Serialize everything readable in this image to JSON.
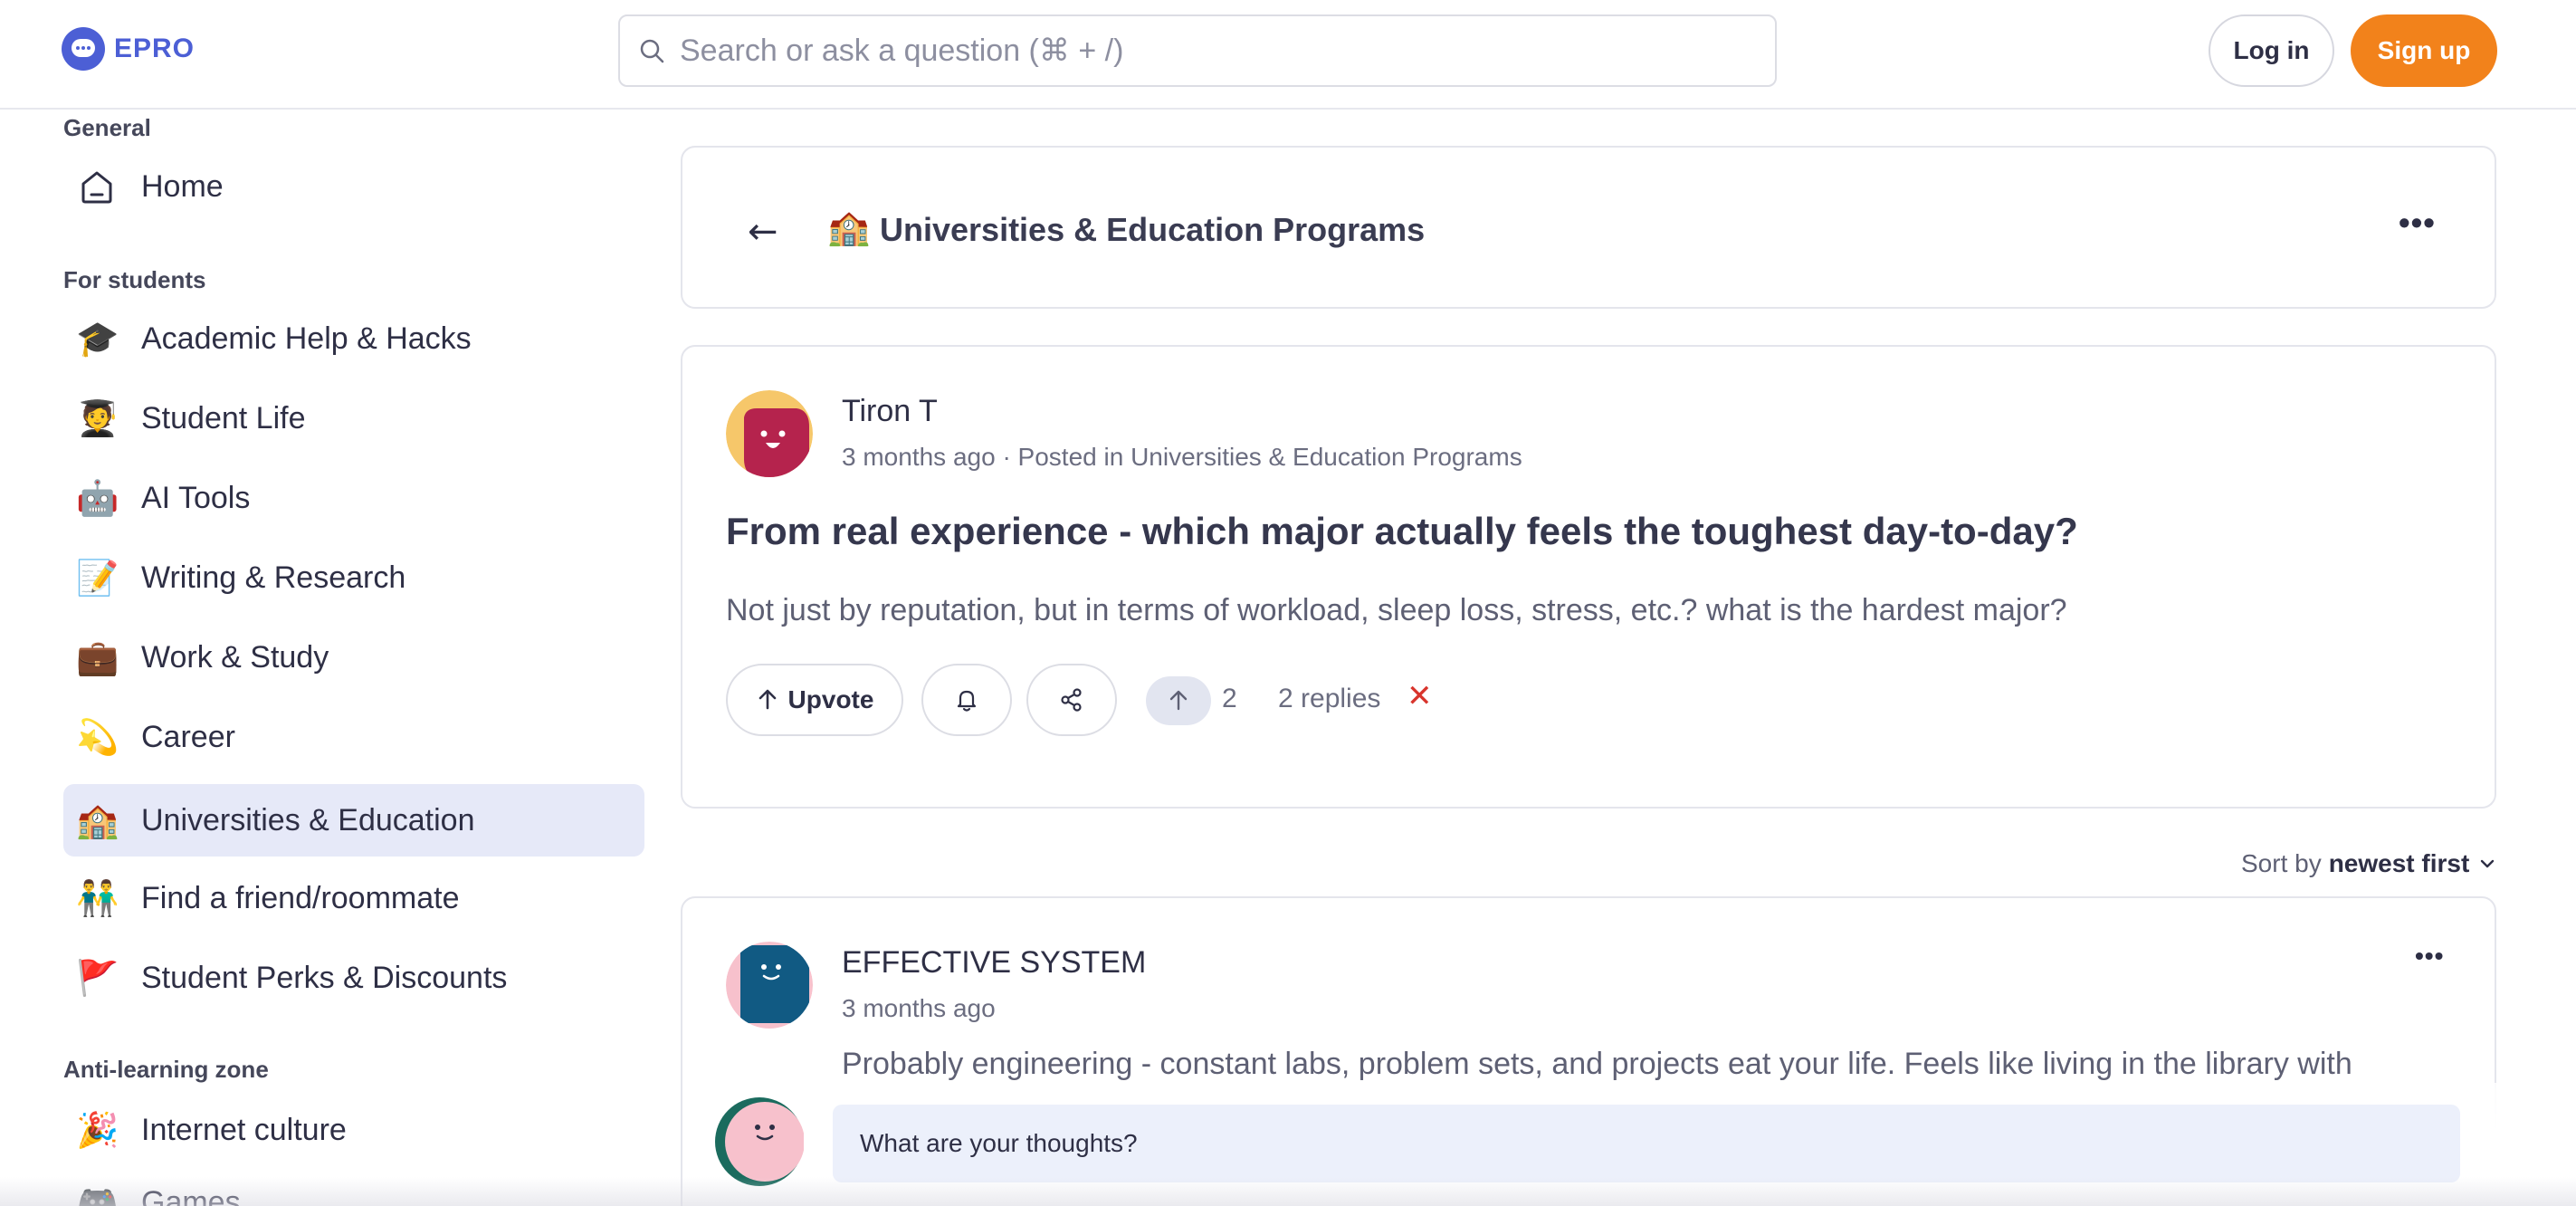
{
  "header": {
    "logo_text": "EPRO",
    "search_placeholder": "Search or ask a question (⌘ + /)",
    "login_label": "Log in",
    "signup_label": "Sign up",
    "accent_color": "#4c5fd5",
    "signup_color": "#f2821b"
  },
  "sidebar": {
    "sections": [
      {
        "title": "General"
      },
      {
        "title": "For students"
      },
      {
        "title": "Anti-learning zone"
      }
    ],
    "items": [
      {
        "label": "Home",
        "icon": "home-icon"
      },
      {
        "label": "Academic Help & Hacks",
        "icon": "graduation-cap-icon",
        "emoji": "🎓"
      },
      {
        "label": "Student Life",
        "icon": "student-icon",
        "emoji": "🧑‍🎓"
      },
      {
        "label": "AI Tools",
        "icon": "robot-icon",
        "emoji": "🤖"
      },
      {
        "label": "Writing & Research",
        "icon": "memo-icon",
        "emoji": "📝"
      },
      {
        "label": "Work & Study",
        "icon": "briefcase-icon",
        "emoji": "💼"
      },
      {
        "label": "Career",
        "icon": "dizzy-icon",
        "emoji": "💫"
      },
      {
        "label": "Universities & Education",
        "icon": "school-icon",
        "emoji": "🏫",
        "active": true
      },
      {
        "label": "Find a friend/roommate",
        "icon": "people-icon",
        "emoji": "👬"
      },
      {
        "label": "Student Perks & Discounts",
        "icon": "flag-icon",
        "emoji": "🚩"
      },
      {
        "label": "Internet culture",
        "icon": "party-popper-icon",
        "emoji": "🎉"
      },
      {
        "label": "Games",
        "icon": "game-controller-icon",
        "emoji": "🎮"
      }
    ]
  },
  "topic": {
    "emoji": "🏫",
    "title": "Universities & Education Programs"
  },
  "post": {
    "author": "Tiron T",
    "meta": "3 months ago · Posted in Universities & Education Programs",
    "title": "From real experience - which major actually feels the toughest day-to-day?",
    "body": "Not just by reputation, but in terms of workload, sleep loss, stress, etc.? what is the hardest major?",
    "upvote_label": "Upvote",
    "vote_count": "2",
    "replies": "2 replies",
    "avatar_color": "#b5234d",
    "avatar_bg": "#f6c76a"
  },
  "sort": {
    "prefix": "Sort by",
    "value": "newest first"
  },
  "reply": {
    "author": "EFFECTIVE SYSTEM",
    "time": "3 months ago",
    "text": "Probably engineering - constant labs, problem sets, and projects eat your life. Feels like living in the library with",
    "avatar_color": "#115a83",
    "avatar_bg": "#f7c1cc"
  },
  "composer": {
    "placeholder": "What are your thoughts?"
  }
}
